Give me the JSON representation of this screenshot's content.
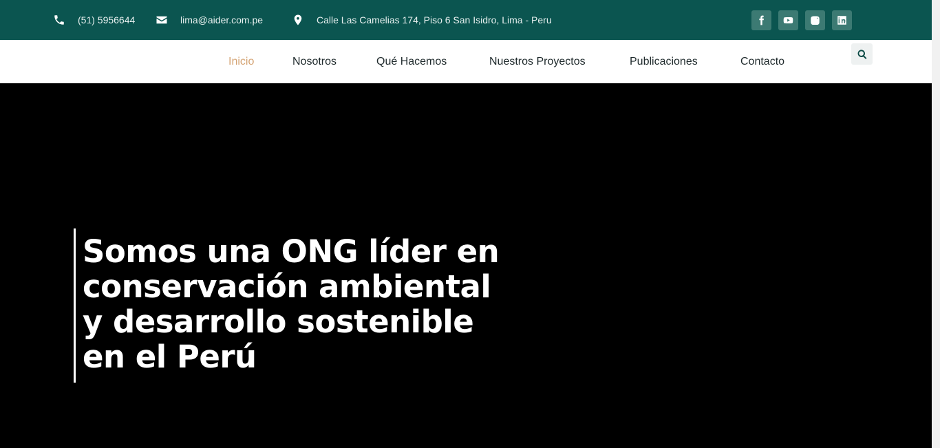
{
  "topbar": {
    "phone": "(51) 5956644",
    "email": "lima@aider.com.pe",
    "address": "Calle Las Camelias 174, Piso 6 San Isidro, Lima - Peru",
    "icons": [
      "phone-icon",
      "envelope-icon",
      "map-marker-icon"
    ],
    "social": [
      "facebook-icon",
      "youtube-icon",
      "instagram-icon",
      "linkedin-icon"
    ],
    "background": "#0b5550"
  },
  "nav": {
    "items": [
      {
        "label": "Inicio",
        "active": true
      },
      {
        "label": "Nosotros"
      },
      {
        "label": "Qué Hacemos"
      },
      {
        "label": "Nuestros Proyectos"
      },
      {
        "label": "Publicaciones"
      },
      {
        "label": "Contacto"
      }
    ],
    "active_color": "#d4a373",
    "search_icon": "search-icon"
  },
  "hero": {
    "heading": "Somos una ONG líder en conservación ambiental y desarrollo sostenible en el Perú",
    "background": "#000000"
  }
}
